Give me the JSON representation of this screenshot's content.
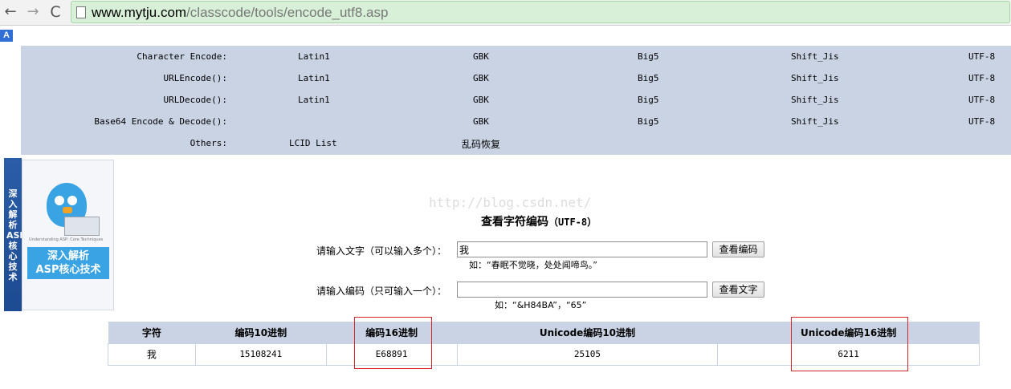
{
  "browser": {
    "url_host": "www.mytju.com",
    "url_path": "/classcode/tools/encode_utf8.asp",
    "back_glyph": "←",
    "forward_glyph": "→",
    "reload_glyph": "C"
  },
  "translate_badge": "A",
  "menu": {
    "rows": [
      {
        "label": "Character Encode:",
        "items": [
          "Latin1",
          "GBK",
          "Big5",
          "Shift_Jis",
          "UTF-8"
        ]
      },
      {
        "label": "URLEncode():",
        "items": [
          "Latin1",
          "GBK",
          "Big5",
          "Shift_Jis",
          "UTF-8"
        ]
      },
      {
        "label": "URLDecode():",
        "items": [
          "Latin1",
          "GBK",
          "Big5",
          "Shift_Jis",
          "UTF-8"
        ]
      },
      {
        "label": "Base64 Encode & Decode():",
        "items": [
          "",
          "GBK",
          "Big5",
          "Shift_Jis",
          "UTF-8"
        ]
      },
      {
        "label": "Others:",
        "items": [
          "LCID List",
          "乱码恢复"
        ]
      }
    ]
  },
  "book": {
    "spine_text": "深入解析ASP核心技术",
    "title_line1": "深入解析",
    "title_line2": "ASP核心技术",
    "subtitle": "Understanding ASP: Core Techniques"
  },
  "watermark": "http://blog.csdn.net/",
  "title": {
    "main": "查看字符编码",
    "sub": "（UTF-8）"
  },
  "form": {
    "text_label": "请输入文字（可以输入多个）：",
    "text_value": "我",
    "text_button": "查看编码",
    "text_hint": "如：“春眠不觉晓，处处闻啼鸟。”",
    "code_label": "请输入编码（只可输入一个）：",
    "code_value": "",
    "code_button": "查看文字",
    "code_hint": "如：“&H84BA”，“65”"
  },
  "result": {
    "headers": [
      "字符",
      "编码10进制",
      "编码16进制",
      "Unicode编码10进制",
      "Unicode编码16进制"
    ],
    "row": [
      "我",
      "15108241",
      "E68891",
      "25105",
      "6211"
    ]
  },
  "colors": {
    "panel": "#c9d3e4",
    "highlight": "#d8262e",
    "urlbar": "#d8f0d8"
  }
}
